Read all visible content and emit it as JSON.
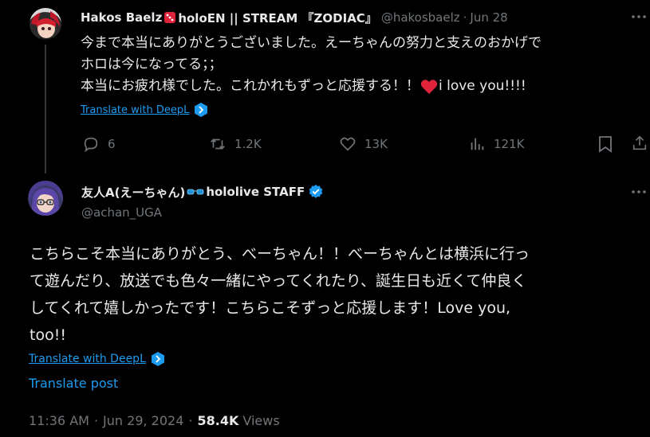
{
  "tweet1": {
    "author_name": "Hakos Baelz",
    "author_suffix": "holoEN || STREAM 『ZODIAC』",
    "handle": "@hakosbaelz",
    "date_sep": "·",
    "date": "Jun 28",
    "text_line1": "今まで本当にありがとうございました。えーちゃんの努力と支えのおかげで",
    "text_line2": "ホロは今になってる；；",
    "text_line3_a": "本当にお疲れ様でした。これかれもずっと応援する！！",
    "text_line3_b": "i love you!!!!",
    "translate_label": "Translate with DeepL",
    "replies": "6",
    "reposts": "1.2K",
    "likes": "13K",
    "views": "121K"
  },
  "tweet2": {
    "author_name": "友人A(えーちゃん)",
    "author_suffix": "hololive STAFF",
    "handle": "@achan_UGA",
    "text_line1": "こちらこそ本当にありがとう、べーちゃん！！べーちゃんとは横浜に行っ",
    "text_line2": "て遊んだり、放送でも色々一緒にやってくれたり、誕生日も近くて仲良く",
    "text_line3": "してくれて嬉しかったです！こちらこそずっと応援します！Love you,",
    "text_line4": "too!!",
    "translate_deepl_label": "Translate with DeepL",
    "translate_post_label": "Translate post",
    "time": "11:36 AM",
    "date_sep": "·",
    "date": "Jun 29, 2024",
    "views_count": "58.4K",
    "views_label": "Views"
  },
  "icons": {
    "dice": "dice-icon",
    "heart_emoji": "red-heart-icon",
    "glasses": "glasses-icon",
    "verified": "verified-badge-icon",
    "deepl": "deepl-icon"
  },
  "colors": {
    "background": "#000000",
    "text": "#e7e9ea",
    "muted": "#71767b",
    "link": "#1d9bf0",
    "verified": "#1d9bf0",
    "heart": "#f91880"
  }
}
